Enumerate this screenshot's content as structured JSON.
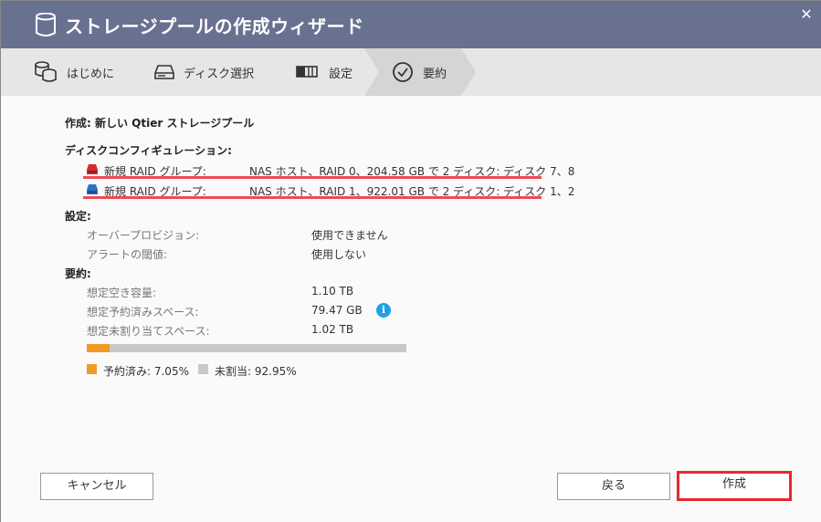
{
  "window": {
    "title": "ストレージプールの作成ウィザード",
    "close_label": "✕"
  },
  "steps": [
    {
      "label": "はじめに",
      "icon": "database-icon"
    },
    {
      "label": "ディスク選択",
      "icon": "disk-drive-icon"
    },
    {
      "label": "設定",
      "icon": "settings-bar-icon"
    },
    {
      "label": "要約",
      "icon": "check-circle-icon",
      "active": true
    }
  ],
  "summary": {
    "create_line": "作成: 新しい Qtier ストレージプール",
    "disk_config_heading": "ディスクコンフィギュレーション:",
    "raid_groups": [
      {
        "label": "新規 RAID グループ:",
        "detail": "NAS ホスト、RAID 0、204.58 GB で 2 ディスク: ディスク 7、8",
        "color": "#d32d2d"
      },
      {
        "label": "新規 RAID グループ:",
        "detail": "NAS ホスト、RAID 1、922.01 GB で 2 ディスク: ディスク 1、2",
        "color": "#2f6fc4"
      }
    ],
    "settings_heading": "設定:",
    "settings": [
      {
        "label": "オーバープロビジョン:",
        "value": "使用できません"
      },
      {
        "label": "アラートの閾値:",
        "value": "使用しない"
      }
    ],
    "summary_heading": "要約:",
    "capacity": [
      {
        "label": "想定空き容量:",
        "value": "1.10 TB"
      },
      {
        "label": "想定予約済みスペース:",
        "value": "79.47 GB"
      },
      {
        "label": "想定未割り当てスペース:",
        "value": "1.02 TB"
      }
    ],
    "info_icon": "i",
    "reserved_fraction": 0.0705,
    "legend": [
      {
        "label": "予約済み: 7.05%",
        "color": "#f39a25"
      },
      {
        "label": "未割当: 92.95%",
        "color": "#c8c8c8"
      }
    ]
  },
  "buttons": {
    "cancel": "キャンセル",
    "back": "戻る",
    "create": "作成"
  }
}
